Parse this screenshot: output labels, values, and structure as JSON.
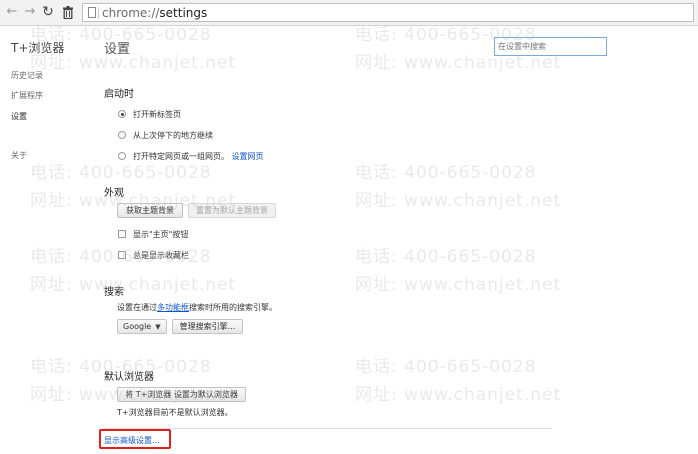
{
  "toolbar": {
    "back_icon": "arrow-left-icon",
    "forward_icon": "arrow-right-icon",
    "reload_icon": "reload-icon",
    "trash_icon": "trash-icon",
    "url_scheme": "chrome://",
    "url_path": "settings"
  },
  "sidebar": {
    "brand": "T+浏览器",
    "items": [
      {
        "label": "历史记录"
      },
      {
        "label": "扩展程序"
      },
      {
        "label": "设置"
      },
      {
        "label": "关于"
      }
    ]
  },
  "main": {
    "title": "设置",
    "search_placeholder": "在设置中搜索",
    "startup": {
      "title": "启动时",
      "options": [
        {
          "label": "打开新标签页",
          "checked": true
        },
        {
          "label": "从上次停下的地方继续",
          "checked": false
        },
        {
          "label": "打开特定网页或一组网页。",
          "checked": false,
          "link": "设置网页"
        }
      ]
    },
    "appearance": {
      "title": "外观",
      "get_themes": "获取主题背景",
      "reset_theme": "重置为默认主题背景",
      "show_home": "显示\"主页\"按钮",
      "show_bookmarks": "总是显示收藏栏"
    },
    "search": {
      "title": "搜索",
      "desc_prefix": "设置在通过",
      "desc_link": "多功能框",
      "desc_suffix": "搜索时所用的搜索引擎。",
      "engine": "Google",
      "manage": "管理搜索引擎..."
    },
    "default_browser": {
      "title": "默认浏览器",
      "set_default": "将 T+浏览器 设置为默认浏览器",
      "status": "T+浏览器目前不是默认浏览器。"
    },
    "advanced_link": "显示高级设置..."
  },
  "watermark": {
    "phone": "电话: 400-665-0028",
    "site": "网址: www.chanjet.net"
  }
}
